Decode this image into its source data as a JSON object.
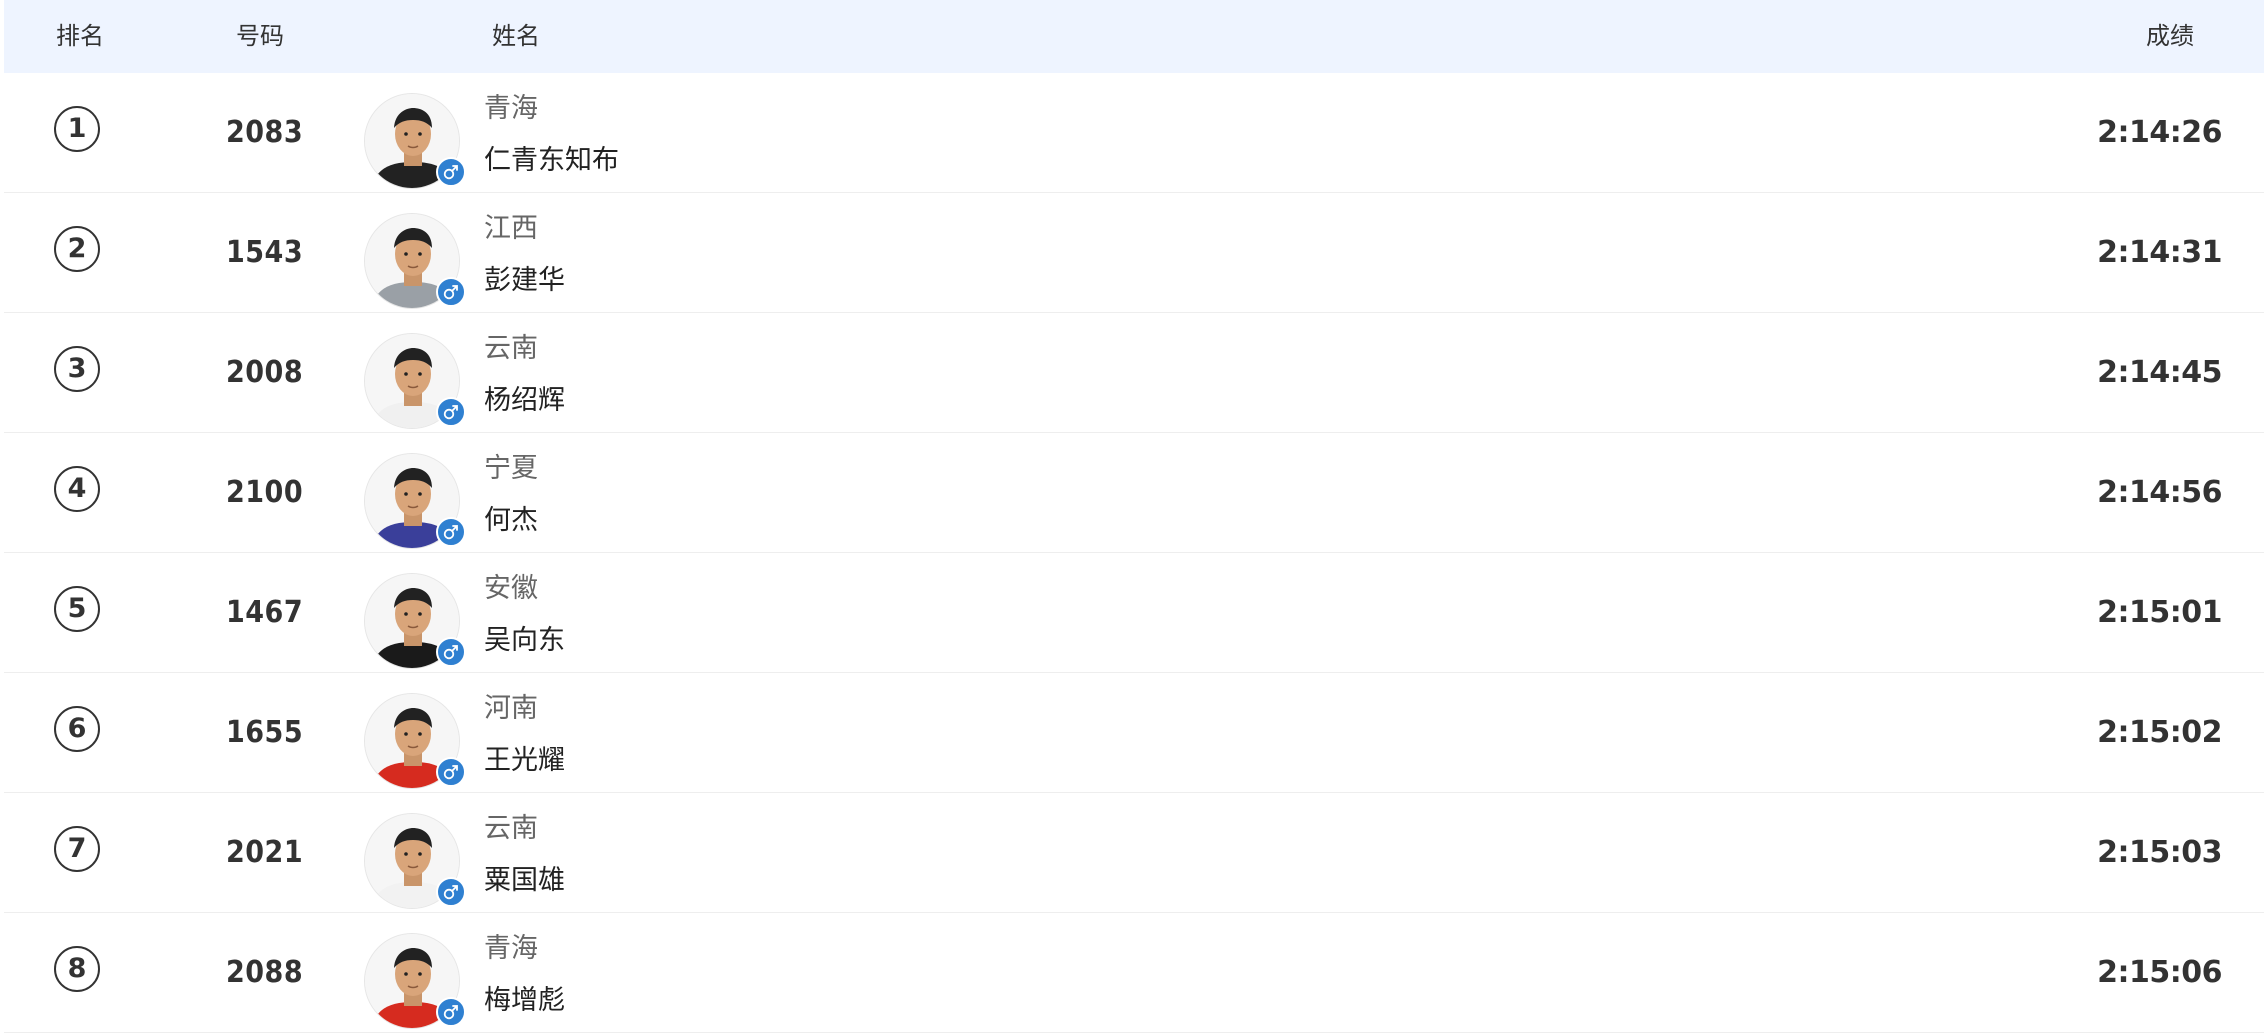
{
  "header": {
    "rank": "排名",
    "bib": "号码",
    "name": "姓名",
    "result": "成绩"
  },
  "rows": [
    {
      "rank": "1",
      "bib": "2083",
      "province": "青海",
      "name": "仁青东知布",
      "result": "2:14:26",
      "gender_icon": "male-icon",
      "jersey": "#222222"
    },
    {
      "rank": "2",
      "bib": "1543",
      "province": "江西",
      "name": "彭建华",
      "result": "2:14:31",
      "gender_icon": "male-icon",
      "jersey": "#9aa0a6"
    },
    {
      "rank": "3",
      "bib": "2008",
      "province": "云南",
      "name": "杨绍辉",
      "result": "2:14:45",
      "gender_icon": "male-icon",
      "jersey": "#f0f0f0"
    },
    {
      "rank": "4",
      "bib": "2100",
      "province": "宁夏",
      "name": "何杰",
      "result": "2:14:56",
      "gender_icon": "male-icon",
      "jersey": "#3a3f9a"
    },
    {
      "rank": "5",
      "bib": "1467",
      "province": "安徽",
      "name": "吴向东",
      "result": "2:15:01",
      "gender_icon": "male-icon",
      "jersey": "#1a1a1a"
    },
    {
      "rank": "6",
      "bib": "1655",
      "province": "河南",
      "name": "王光耀",
      "result": "2:15:02",
      "gender_icon": "male-icon",
      "jersey": "#d62b1f"
    },
    {
      "rank": "7",
      "bib": "2021",
      "province": "云南",
      "name": "粟国雄",
      "result": "2:15:03",
      "gender_icon": "male-icon",
      "jersey": "#f2f2f2"
    },
    {
      "rank": "8",
      "bib": "2088",
      "province": "青海",
      "name": "梅增彪",
      "result": "2:15:06",
      "gender_icon": "male-icon",
      "jersey": "#d62b1f"
    }
  ],
  "colors": {
    "header_bg": "#eef4ff",
    "gender_badge": "#2f80d1",
    "row_divider": "#eeeeee"
  }
}
